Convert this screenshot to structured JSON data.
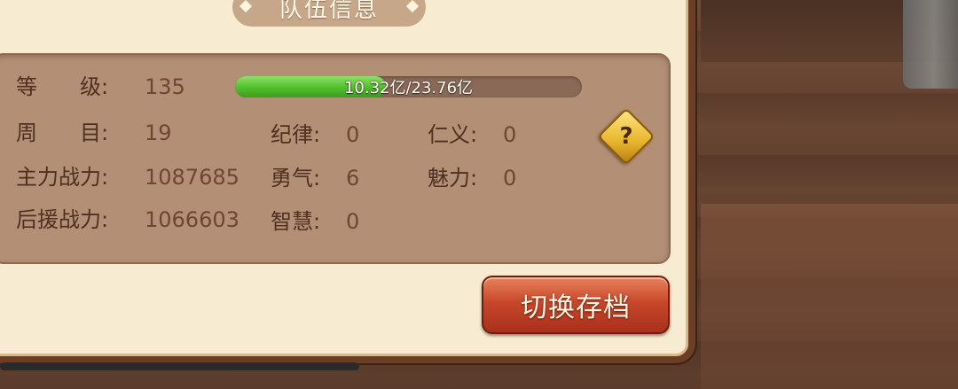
{
  "panel": {
    "title": "队伍信息"
  },
  "stats": {
    "level": {
      "label": "等　　级:",
      "value": "135"
    },
    "progress": {
      "text": "10.32亿/23.76亿",
      "fraction": 0.434
    },
    "cycle": {
      "label": "周　　目:",
      "value": "19"
    },
    "main_power": {
      "label": "主力战力:",
      "value": "1087685"
    },
    "backup_power": {
      "label": "后援战力:",
      "value": "1066603"
    },
    "discipline": {
      "label": "纪律:",
      "value": "0"
    },
    "courage": {
      "label": "勇气:",
      "value": "6"
    },
    "wisdom": {
      "label": "智慧:",
      "value": "0"
    },
    "benevolence": {
      "label": "仁义:",
      "value": "0"
    },
    "charm": {
      "label": "魅力:",
      "value": "0"
    }
  },
  "help_icon": {
    "glyph": "?"
  },
  "switch_button": {
    "label": "切换存档"
  },
  "colors": {
    "accent_button": "#c8472a",
    "progress_fill": "#4fbf2a",
    "help_icon": "#e8b52c"
  }
}
